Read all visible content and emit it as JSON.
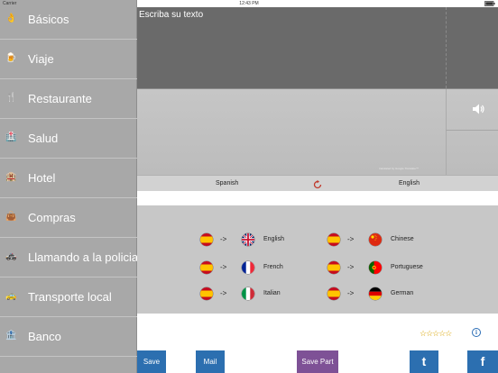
{
  "status_bar": {
    "carrier": "Carrier",
    "time": "12:43 PM"
  },
  "sidebar": {
    "items": [
      {
        "label": "Básicos",
        "icon": "hand-icon",
        "glyph": "👌"
      },
      {
        "label": "Viaje",
        "icon": "travel-icon",
        "glyph": "🍺"
      },
      {
        "label": "Restaurante",
        "icon": "restaurant-icon",
        "glyph": "🍴"
      },
      {
        "label": "Salud",
        "icon": "health-icon",
        "glyph": "🏥"
      },
      {
        "label": "Hotel",
        "icon": "hotel-icon",
        "glyph": "🏨"
      },
      {
        "label": "Compras",
        "icon": "shopping-icon",
        "glyph": "👜"
      },
      {
        "label": "Llamando a la policia",
        "icon": "police-car-icon",
        "glyph": "🚓"
      },
      {
        "label": "Transporte local",
        "icon": "taxi-icon",
        "glyph": "🚕"
      },
      {
        "label": "Banco",
        "icon": "bank-icon",
        "glyph": "🏦"
      }
    ]
  },
  "translator": {
    "input_placeholder": "Escriba su texto",
    "credit": "translated by Google Translate™"
  },
  "language_bar": {
    "source": "Spanish",
    "target": "English"
  },
  "pairs": [
    {
      "src": "es",
      "dst": "gb",
      "arrow": "->",
      "label": "English"
    },
    {
      "src": "es",
      "dst": "cn",
      "arrow": "->",
      "label": "Chinese"
    },
    {
      "src": "es",
      "dst": "fr",
      "arrow": "->",
      "label": "French"
    },
    {
      "src": "es",
      "dst": "pt",
      "arrow": "->",
      "label": "Portuguese"
    },
    {
      "src": "es",
      "dst": "it",
      "arrow": "->",
      "label": "Italian"
    },
    {
      "src": "es",
      "dst": "de",
      "arrow": "->",
      "label": "German"
    }
  ],
  "rating": {
    "stars": "☆☆☆☆☆",
    "info": "i"
  },
  "buttons": {
    "save": "Save",
    "mail": "Mail",
    "save_part": "Save Part",
    "twitter": "t",
    "facebook": "f"
  },
  "colors": {
    "sidebar_bg": "#a8a8a8",
    "input_bg": "#6a6a6a",
    "button_blue": "#2c6fb0",
    "button_purple": "#7e5196"
  }
}
